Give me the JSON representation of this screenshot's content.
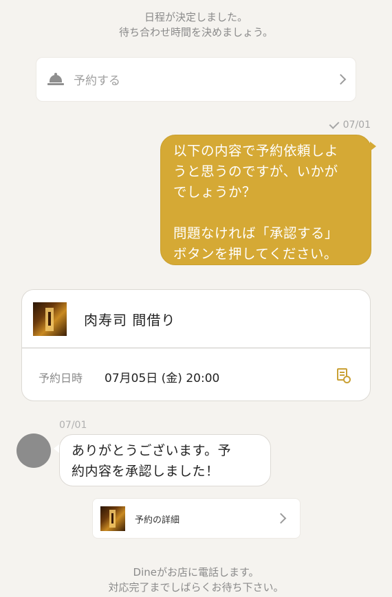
{
  "system_notes": {
    "top_line1": "日程が決定しました。",
    "top_line2": "待ち合わせ時間を決めましょう。",
    "bottom_line1": "Dineがお店に電話します。",
    "bottom_line2": "対応完了までしばらくお待ち下さい。"
  },
  "reserve_action": {
    "label": "予約する",
    "icon": "service-bell-icon"
  },
  "outgoing_message": {
    "date": "07/01",
    "read_icon": "check-icon",
    "lines": [
      "以下の内容で予約依頼しよ",
      "うと思うのですが、いかが",
      "でしょうか？",
      "",
      "問題なければ「承認する」",
      "ボタンを押してください。"
    ],
    "bubble_color": "#d5a935"
  },
  "reservation_card": {
    "restaurant_name": "肉寿司 間借り",
    "date_label": "予約日時",
    "date_value": "07月05日 (金) 20:00",
    "detail_icon": "document-search-icon"
  },
  "incoming_message": {
    "date": "07/01",
    "lines": [
      "ありがとうございます。予",
      "約内容を承認しました！"
    ]
  },
  "detail_link": {
    "label": "予約の詳細"
  }
}
